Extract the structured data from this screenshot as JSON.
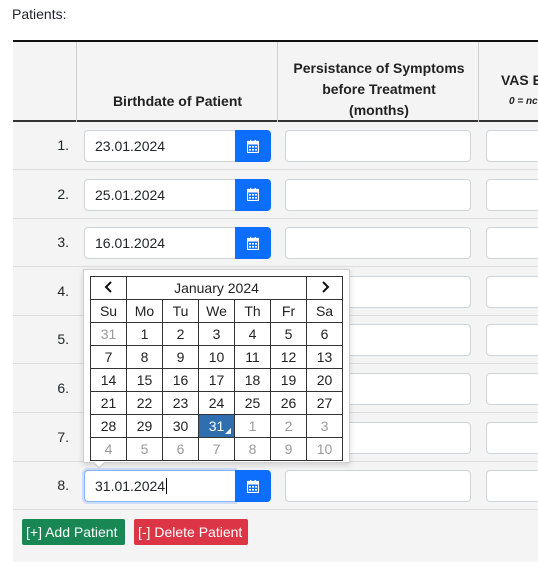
{
  "section_label": "Patients:",
  "headers": {
    "birthdate": "Birthdate of Patient",
    "persistence_line1": "Persistance of Symptoms",
    "persistence_line2": "before Treatment",
    "persistence_line3": "(months)",
    "vas": "VAS E",
    "vas_sub": "0 = nc"
  },
  "rows": [
    {
      "num": "1.",
      "date": "23.01.2024"
    },
    {
      "num": "2.",
      "date": "25.01.2024"
    },
    {
      "num": "3.",
      "date": "16.01.2024"
    },
    {
      "num": "4.",
      "date": ""
    },
    {
      "num": "5.",
      "date": ""
    },
    {
      "num": "6.",
      "date": ""
    },
    {
      "num": "7.",
      "date": ""
    },
    {
      "num": "8.",
      "date": "31.01.2024"
    }
  ],
  "datepicker": {
    "month_title": "January 2024",
    "prev_icon": "chevron-left-icon",
    "next_icon": "chevron-right-icon",
    "weekdays": [
      "Su",
      "Mo",
      "Tu",
      "We",
      "Th",
      "Fr",
      "Sa"
    ],
    "weeks": [
      [
        "31",
        "1",
        "2",
        "3",
        "4",
        "5",
        "6"
      ],
      [
        "7",
        "8",
        "9",
        "10",
        "11",
        "12",
        "13"
      ],
      [
        "14",
        "15",
        "16",
        "17",
        "18",
        "19",
        "20"
      ],
      [
        "21",
        "22",
        "23",
        "24",
        "25",
        "26",
        "27"
      ],
      [
        "28",
        "29",
        "30",
        "31",
        "1",
        "2",
        "3"
      ],
      [
        "4",
        "5",
        "6",
        "7",
        "8",
        "9",
        "10"
      ]
    ],
    "selected_day": "31"
  },
  "buttons": {
    "add": "[+] Add Patient",
    "delete": "[-] Delete Patient"
  },
  "colors": {
    "primary": "#0d6efd",
    "add": "#198754",
    "delete": "#dc3545",
    "selected_day": "#2f6fb0"
  }
}
